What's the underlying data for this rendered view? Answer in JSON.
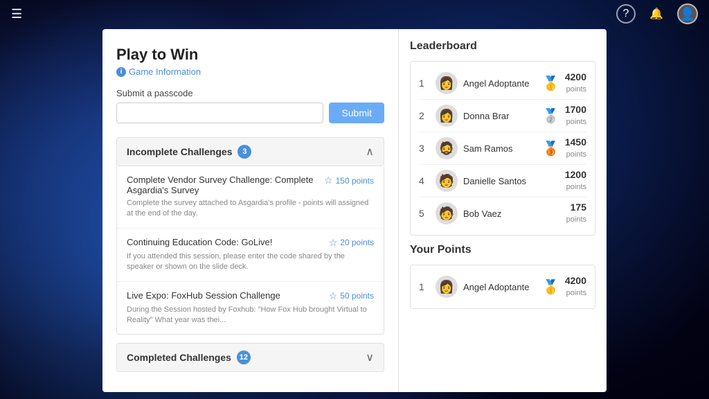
{
  "topbar": {
    "hamburger_icon": "☰",
    "help_icon": "?",
    "bell_icon": "🔔",
    "avatar_emoji": "👤"
  },
  "left": {
    "page_title": "Play to Win",
    "game_info_label": "Game Information",
    "passcode_label": "Submit a passcode",
    "passcode_placeholder": "",
    "submit_label": "Submit",
    "incomplete_section": {
      "title": "Incomplete Challenges",
      "badge": "3",
      "challenges": [
        {
          "title": "Complete Vendor Survey Challenge: Complete Asgardia's Survey",
          "description": "Complete the survey attached to Asgardia's profile - points will assigned at the end of the day.",
          "points": "150 points"
        },
        {
          "title": "Continuing Education Code: GoLive!",
          "description": "If you attended this session, please enter the code shared by the speaker or shown on the slide deck.",
          "points": "20 points"
        },
        {
          "title": "Live Expo: FoxHub Session Challenge",
          "description": "During the Session hosted by Foxhub: \"How Fox Hub brought Virtual to Reality\" What year was thei...",
          "points": "50 points"
        }
      ]
    },
    "completed_section": {
      "title": "Completed Challenges",
      "badge": "12"
    }
  },
  "right": {
    "leaderboard_title": "Leaderboard",
    "leaderboard_rows": [
      {
        "rank": "1",
        "name": "Angel Adoptante",
        "points_num": "4200",
        "points_word": "points",
        "medal": "🥇",
        "medal_class": "medal-gold",
        "avatar": "👩"
      },
      {
        "rank": "2",
        "name": "Donna Brar",
        "points_num": "1700",
        "points_word": "points",
        "medal": "🥈",
        "medal_class": "medal-silver",
        "avatar": "👩"
      },
      {
        "rank": "3",
        "name": "Sam Ramos",
        "points_num": "1450",
        "points_word": "points",
        "medal": "🥉",
        "medal_class": "medal-bronze",
        "avatar": "🧔"
      },
      {
        "rank": "4",
        "name": "Danielle Santos",
        "points_num": "1200",
        "points_word": "points",
        "medal": "",
        "medal_class": "",
        "avatar": "🧑"
      },
      {
        "rank": "5",
        "name": "Bob Vaez",
        "points_num": "175",
        "points_word": "points",
        "medal": "",
        "medal_class": "",
        "avatar": "🧑"
      }
    ],
    "yourpoints_title": "Your Points",
    "yourpoints_rows": [
      {
        "rank": "1",
        "name": "Angel Adoptante",
        "points_num": "4200",
        "points_word": "points",
        "medal": "🥇",
        "medal_class": "medal-gold",
        "avatar": "👩"
      }
    ]
  }
}
